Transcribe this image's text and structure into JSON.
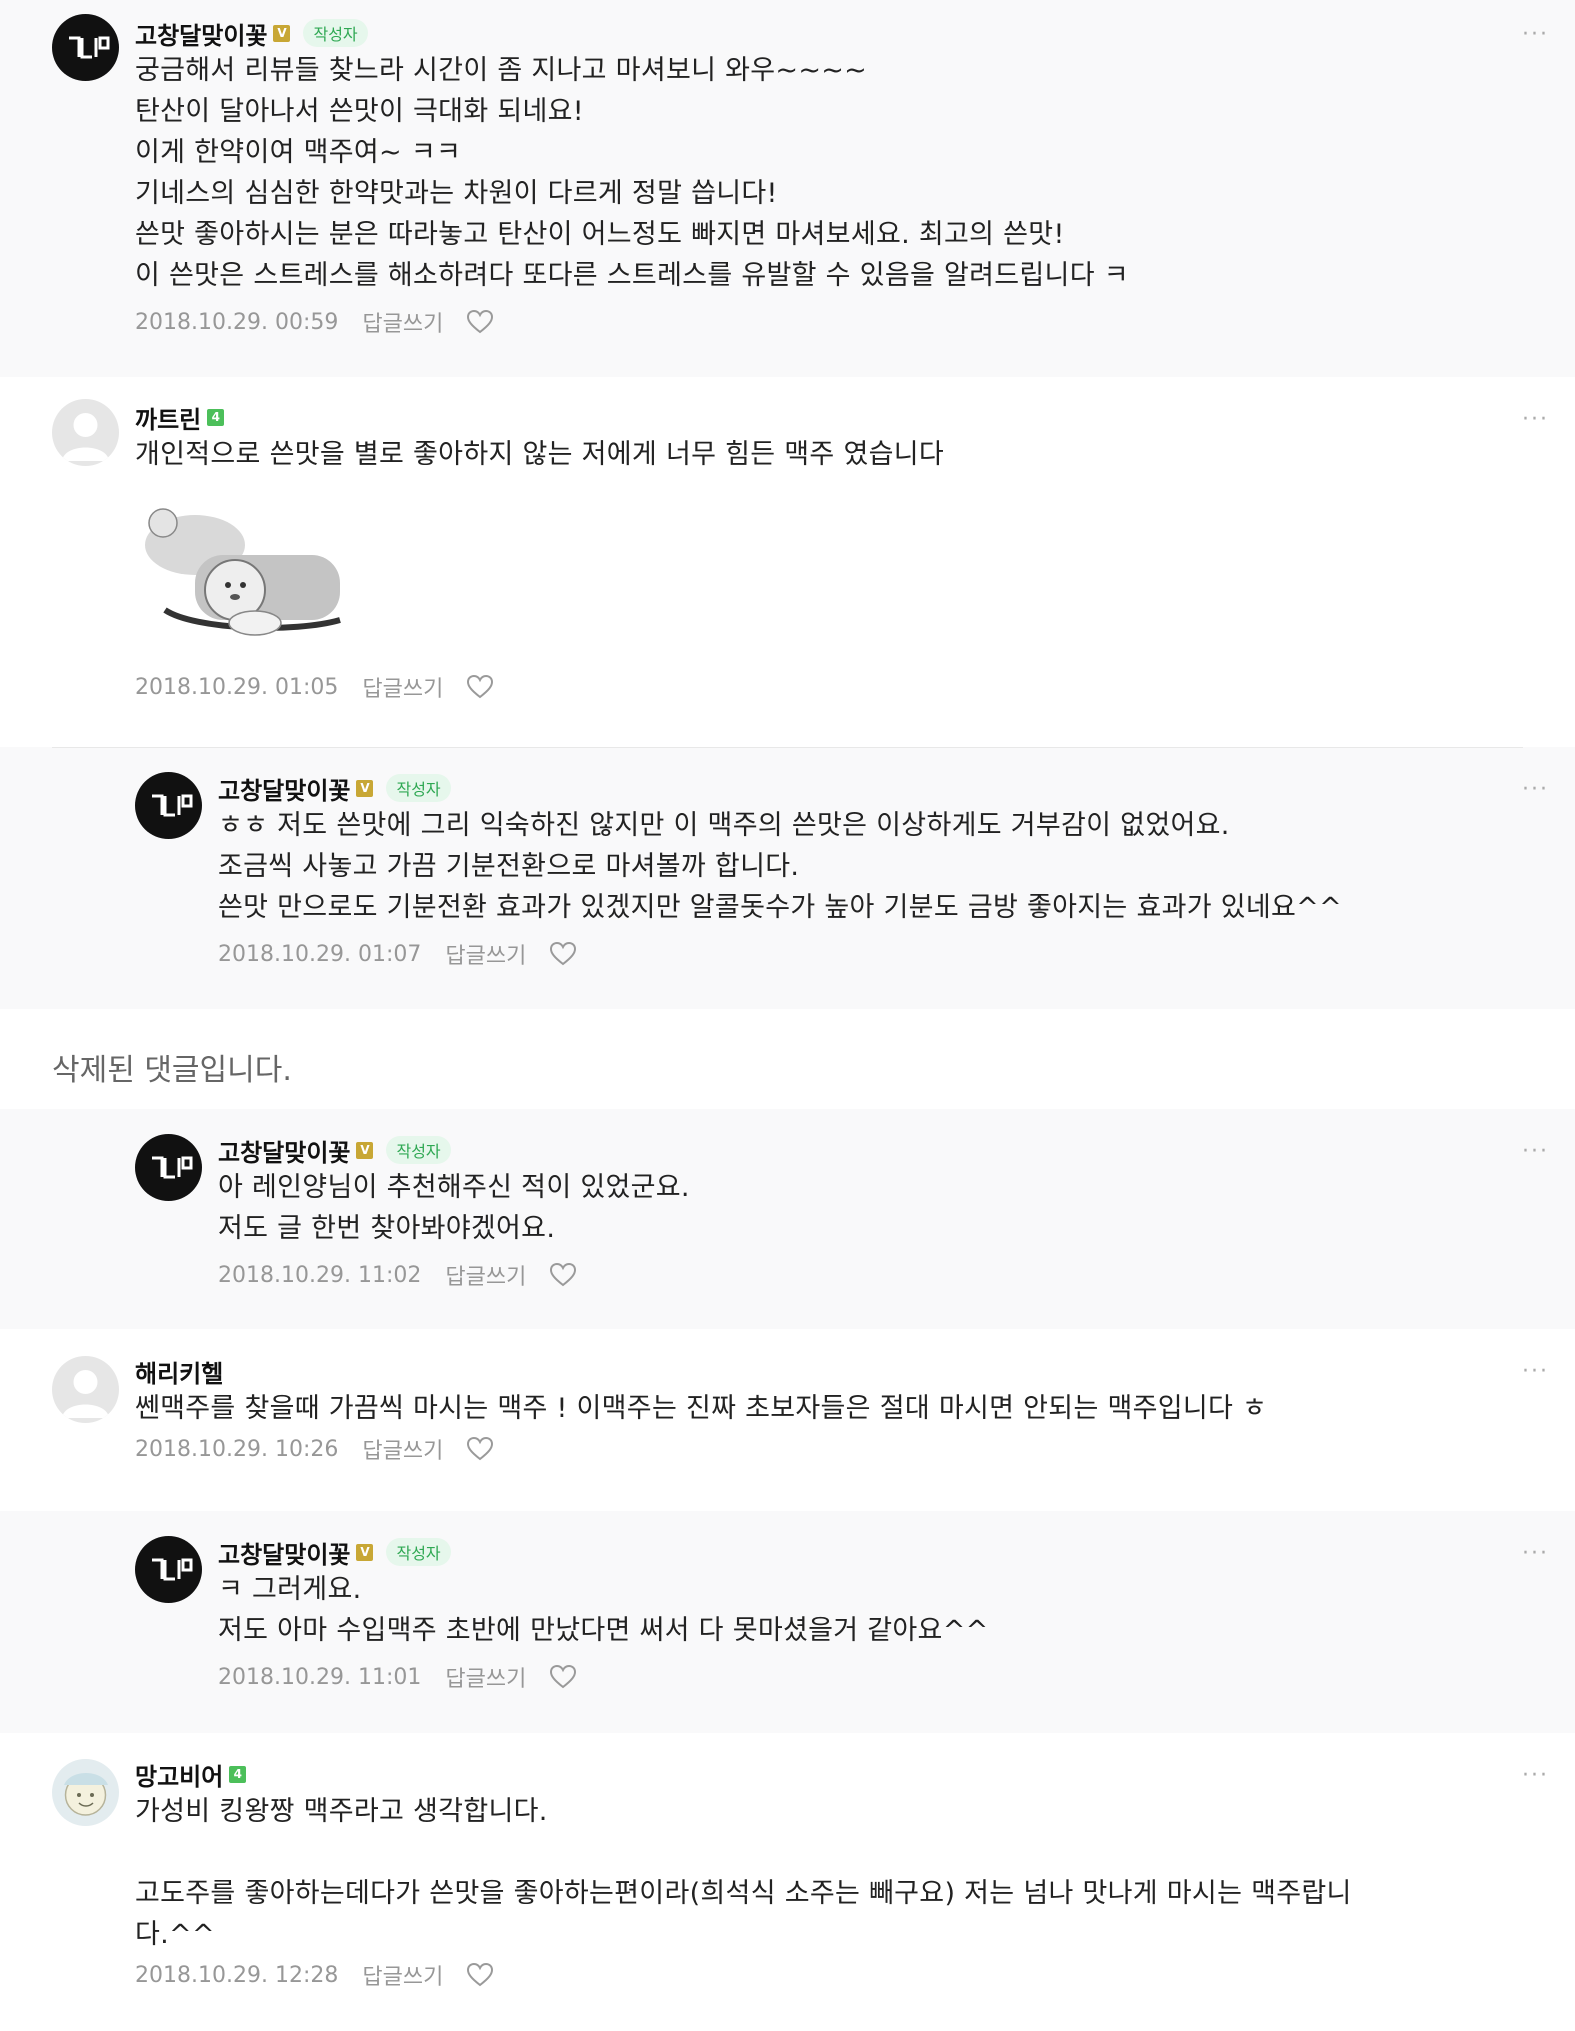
{
  "ui": {
    "more_label": "···",
    "reply_label": "답글쓰기",
    "author_tag": "작성자"
  },
  "comments": [
    {
      "nick": "고창달맞이꽃",
      "badge": "V",
      "lines": "궁금해서 리뷰들 찾느라 시간이 좀 지나고 마셔보니 와우~~~~\n탄산이 달아나서 쓴맛이 극대화 되네요!\n이게 한약이여 맥주여~ ㅋㅋ\n기네스의 심심한 한약맛과는 차원이 다르게 정말 씁니다!\n쓴맛 좋아하시는 분은 따라놓고 탄산이 어느정도 빠지면 마셔보세요. 최고의 쓴맛!\n이 쓴맛은 스트레스를 해소하려다 또다른 스트레스를 유발할 수 있음을 알려드립니다 ㅋ",
      "date": "2018.10.29. 00:59"
    },
    {
      "nick": "까트린",
      "badge": "4",
      "lines": "개인적으로 쓴맛을 별로 좋아하지 않는 저에게 너무 힘든 맥주 였습니다",
      "date": "2018.10.29. 01:05"
    },
    {
      "nick": "고창달맞이꽃",
      "badge": "V",
      "lines": "ㅎㅎ 저도 쓴맛에 그리 익숙하진 않지만 이 맥주의 쓴맛은 이상하게도 거부감이 없었어요.\n조금씩 사놓고 가끔 기분전환으로 마셔볼까 합니다.\n쓴맛 만으로도 기분전환 효과가 있겠지만 알콜돗수가 높아 기분도 금방 좋아지는 효과가 있네요^^",
      "date": "2018.10.29. 01:07"
    },
    {
      "deleted_text": "삭제된 댓글입니다."
    },
    {
      "nick": "고창달맞이꽃",
      "badge": "V",
      "lines": "아 레인양님이 추천해주신 적이 있었군요.\n저도 글 한번 찾아봐야겠어요.",
      "date": "2018.10.29. 11:02"
    },
    {
      "nick": "해리키헬",
      "lines": "쎈맥주를 찾을때 가끔씩 마시는 맥주 ! 이맥주는 진짜 초보자들은 절대 마시면 안되는 맥주입니다 ㅎ",
      "date": "2018.10.29. 10:26"
    },
    {
      "nick": "고창달맞이꽃",
      "badge": "V",
      "lines": "ㅋ 그러게요.\n저도 아마 수입맥주 초반에 만났다면 써서 다 못마셨을거 같아요^^",
      "date": "2018.10.29. 11:01"
    },
    {
      "nick": "망고비어",
      "badge": "4",
      "lines": "가성비 킹왕짱 맥주라고 생각합니다.\n\n고도주를 좋아하는데다가 쓴맛을 좋아하는편이라(희석식 소주는 빼구요) 저는 넘나 맛나게 마시는 맥주랍니\n다.^^",
      "date": "2018.10.29. 12:28"
    }
  ]
}
